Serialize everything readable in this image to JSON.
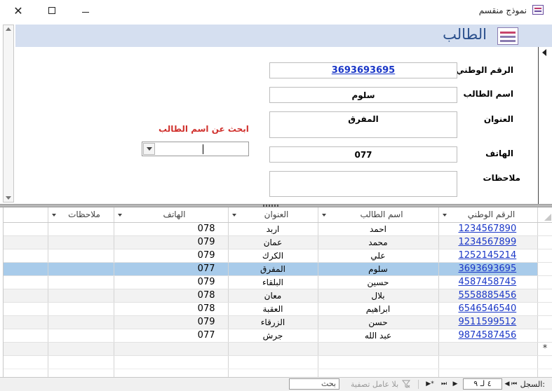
{
  "window": {
    "title": "نموذج منقسم",
    "close_glyph": "✕"
  },
  "form": {
    "header_title": "الطالب",
    "fields": {
      "national_id_label": "الرقم الوطني",
      "national_id_value": "3693693695",
      "name_label": "اسم الطالب",
      "name_value": "سلوم",
      "address_label": "العنوان",
      "address_value": "المفرق",
      "phone_label": "الهاتف",
      "phone_value": "077",
      "notes_label": "ملاحظات",
      "notes_value": ""
    },
    "search": {
      "label": "ابحث عن اسم الطالب",
      "value": ""
    }
  },
  "datasheet": {
    "columns": [
      "الرقم الوطني",
      "اسم الطالب",
      "العنوان",
      "الهاتف",
      "ملاحظات"
    ],
    "selected_index": 3,
    "rows": [
      {
        "id": "1234567890",
        "name": "احمد",
        "address": "اربد",
        "phone": "078",
        "notes": ""
      },
      {
        "id": "1234567899",
        "name": "محمد",
        "address": "عمان",
        "phone": "079",
        "notes": ""
      },
      {
        "id": "1252145214",
        "name": "علي",
        "address": "الكرك",
        "phone": "079",
        "notes": ""
      },
      {
        "id": "3693693695",
        "name": "سلوم",
        "address": "المفرق",
        "phone": "077",
        "notes": ""
      },
      {
        "id": "4587458745",
        "name": "حسين",
        "address": "البلقاء",
        "phone": "079",
        "notes": ""
      },
      {
        "id": "5558885456",
        "name": "بلال",
        "address": "معان",
        "phone": "078",
        "notes": ""
      },
      {
        "id": "6546546540",
        "name": "ابراهيم",
        "address": "العقبة",
        "phone": "078",
        "notes": ""
      },
      {
        "id": "9511599512",
        "name": "حسن",
        "address": "الزرقاء",
        "phone": "079",
        "notes": ""
      },
      {
        "id": "9874587456",
        "name": "عبد الله",
        "address": "جرش",
        "phone": "077",
        "notes": ""
      }
    ],
    "new_row_glyph": "*"
  },
  "navigation": {
    "record_label": "السجل:",
    "position": "٤ لـ ٩",
    "filter_text": "بلا عامل تصفية",
    "search_text": "بحث",
    "first_glyph": "⏮",
    "prev_glyph": "◀",
    "next_glyph": "▶",
    "last_glyph": "⏭",
    "new_glyph": "▶*"
  }
}
